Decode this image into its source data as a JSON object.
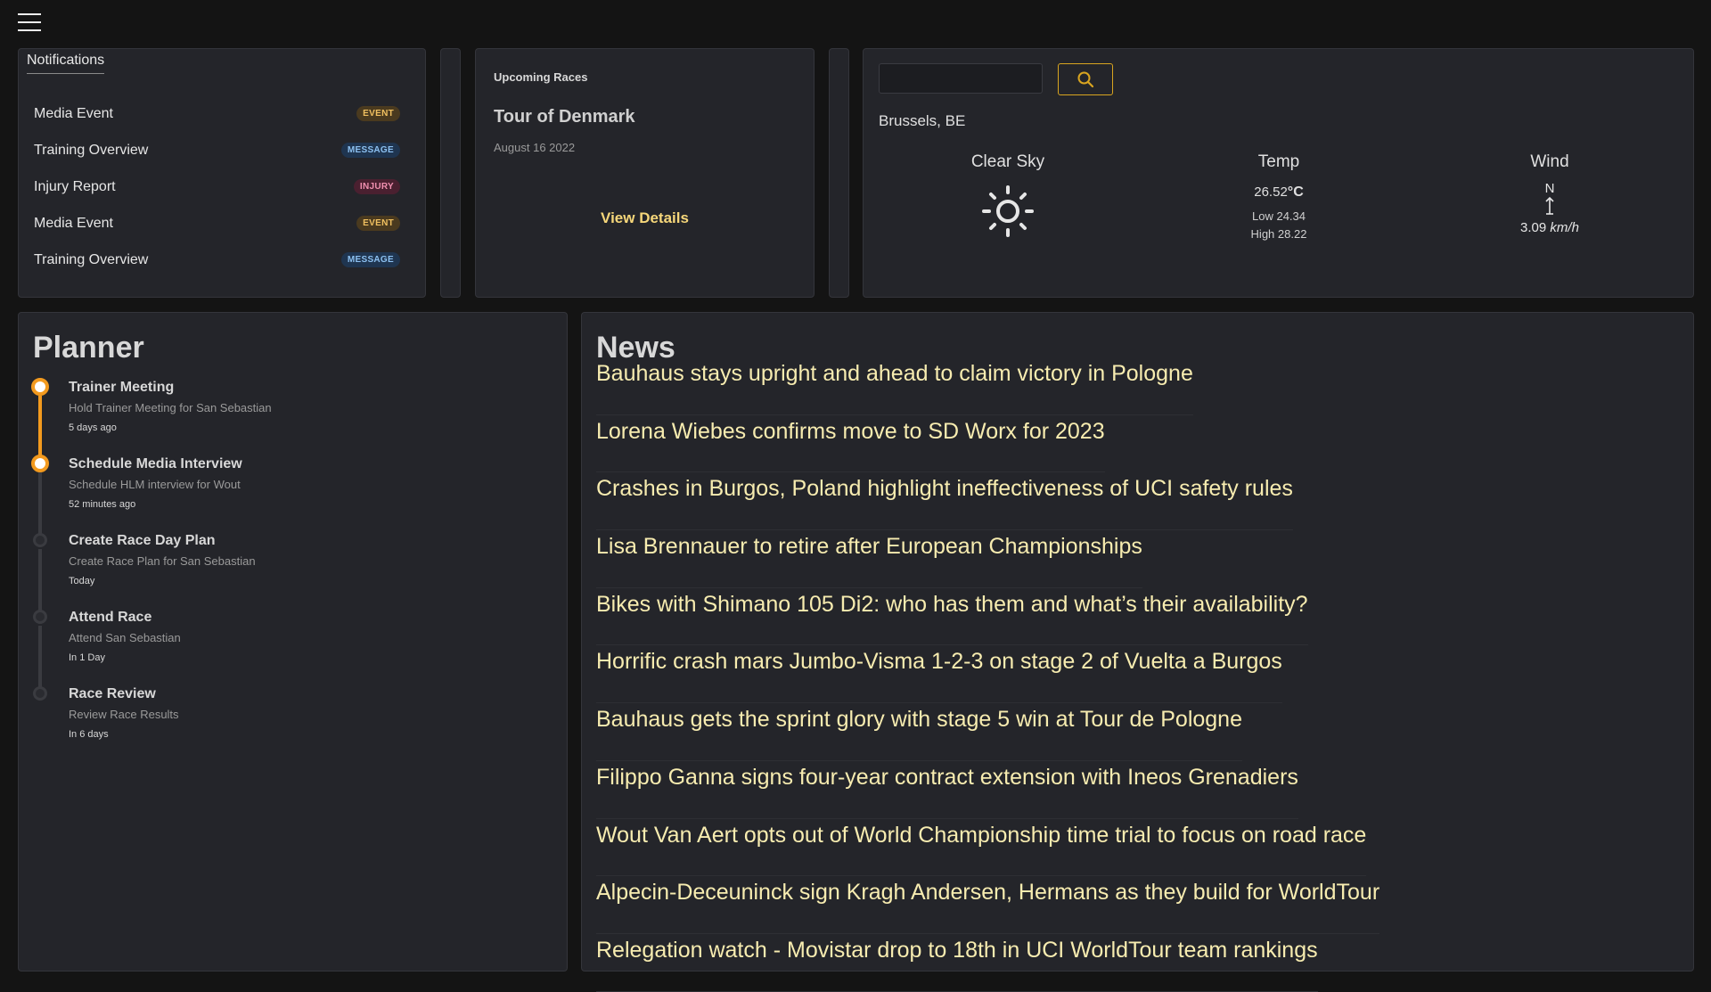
{
  "notifications": {
    "tab_label": "Notifications",
    "items": [
      {
        "label": "Media Event",
        "badge": "EVENT",
        "type": "event"
      },
      {
        "label": "Training Overview",
        "badge": "MESSAGE",
        "type": "message"
      },
      {
        "label": "Injury Report",
        "badge": "INJURY",
        "type": "injury"
      },
      {
        "label": "Media Event",
        "badge": "EVENT",
        "type": "event"
      },
      {
        "label": "Training Overview",
        "badge": "MESSAGE",
        "type": "message"
      }
    ]
  },
  "races": {
    "heading": "Upcoming Races",
    "name": "Tour of Denmark",
    "date": "August 16 2022",
    "details_label": "View Details"
  },
  "weather": {
    "search_value": "",
    "search_icon": "search-icon",
    "city": "Brussels, BE",
    "condition_label": "Clear Sky",
    "condition_icon": "sun-icon",
    "temp_label": "Temp",
    "temp_value": "26.52",
    "temp_unit": "°C",
    "low": "Low 24.34",
    "high": "High 28.22",
    "wind_label": "Wind",
    "wind_dir": "N",
    "wind_icon": "arrow-up-down-icon",
    "wind_speed": "3.09",
    "wind_unit": "km/h"
  },
  "planner": {
    "title": "Planner",
    "items": [
      {
        "title": "Trainer Meeting",
        "desc": "Hold Trainer Meeting for San Sebastian",
        "time": "5 days ago",
        "done": true
      },
      {
        "title": "Schedule Media Interview",
        "desc": "Schedule HLM interview for Wout",
        "time": "52 minutes ago",
        "done": true
      },
      {
        "title": "Create Race Day Plan",
        "desc": "Create Race Plan for San Sebastian",
        "time": "Today",
        "done": false
      },
      {
        "title": "Attend Race",
        "desc": "Attend San Sebastian",
        "time": "In 1 Day",
        "done": false
      },
      {
        "title": "Race Review",
        "desc": "Review Race Results",
        "time": "In 6 days",
        "done": false
      }
    ]
  },
  "news": {
    "title": "News",
    "items": [
      "Bauhaus stays upright and ahead to claim victory in Pologne",
      "Lorena Wiebes confirms move to SD Worx for 2023",
      "Crashes in Burgos, Poland highlight ineffectiveness of UCI safety rules",
      "Lisa Brennauer to retire after European Championships",
      "Bikes with Shimano 105 Di2: who has them and what’s their availability?",
      "Horrific crash mars Jumbo-Visma 1-2-3 on stage 2 of Vuelta a Burgos",
      "Bauhaus gets the sprint glory with stage 5 win at Tour de Pologne",
      "Filippo Ganna signs four-year contract extension with Ineos Grenadiers",
      "Wout Van Aert opts out of World Championship time trial to focus on road race",
      "Alpecin-Deceuninck sign Kragh Andersen, Hermans as they build for WorldTour",
      "Relegation watch - Movistar drop to 18th in UCI WorldTour team rankings"
    ]
  },
  "colors": {
    "accent": "#f39a1e",
    "news_link": "#f7ecb0",
    "card_bg": "#24252a"
  }
}
